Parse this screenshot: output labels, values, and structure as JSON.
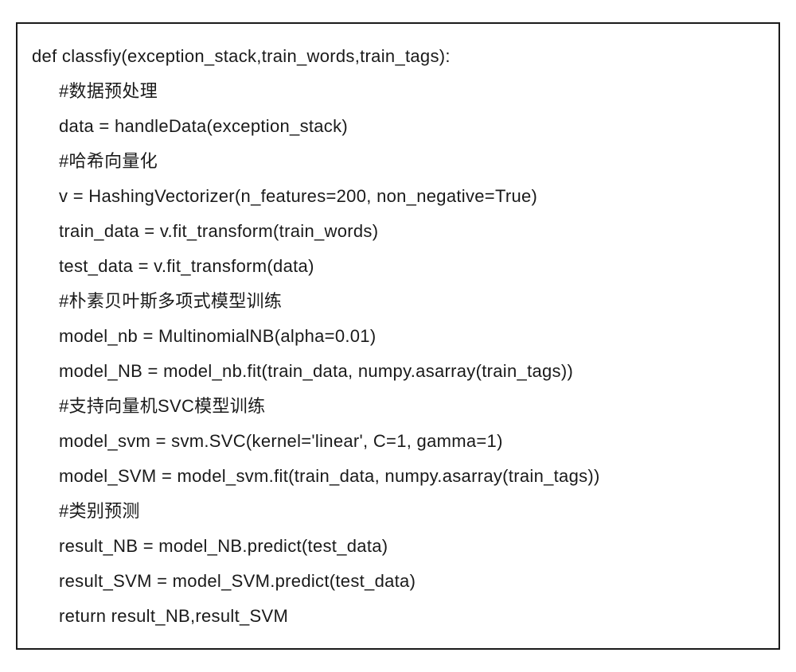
{
  "code": {
    "lines": [
      {
        "text": "def classfiy(exception_stack,train_words,train_tags):",
        "indent": false
      },
      {
        "text": "#数据预处理",
        "indent": true
      },
      {
        "text": "data = handleData(exception_stack)",
        "indent": true
      },
      {
        "text": "#哈希向量化",
        "indent": true
      },
      {
        "text": "v = HashingVectorizer(n_features=200, non_negative=True)",
        "indent": true
      },
      {
        "text": "train_data = v.fit_transform(train_words)",
        "indent": true
      },
      {
        "text": "test_data = v.fit_transform(data)",
        "indent": true
      },
      {
        "text": "#朴素贝叶斯多项式模型训练",
        "indent": true
      },
      {
        "text": "model_nb = MultinomialNB(alpha=0.01)",
        "indent": true
      },
      {
        "text": "model_NB = model_nb.fit(train_data, numpy.asarray(train_tags))",
        "indent": true
      },
      {
        "text": "#支持向量机SVC模型训练",
        "indent": true
      },
      {
        "text": "model_svm = svm.SVC(kernel='linear', C=1, gamma=1)",
        "indent": true
      },
      {
        "text": "model_SVM = model_svm.fit(train_data, numpy.asarray(train_tags))",
        "indent": true
      },
      {
        "text": "#类别预测",
        "indent": true
      },
      {
        "text": "result_NB = model_NB.predict(test_data)",
        "indent": true
      },
      {
        "text": "result_SVM = model_SVM.predict(test_data)",
        "indent": true
      },
      {
        "text": "return result_NB,result_SVM",
        "indent": true
      }
    ]
  }
}
